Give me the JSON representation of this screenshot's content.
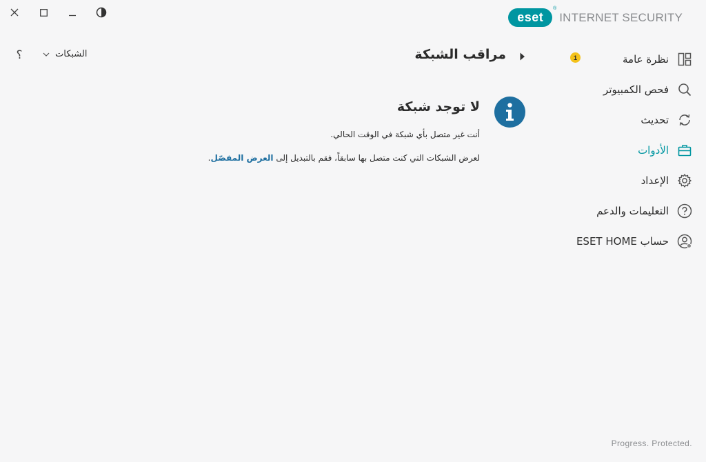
{
  "window": {
    "close_icon": "close-icon",
    "maximize_icon": "maximize-icon",
    "minimize_icon": "minimize-icon",
    "theme_icon": "contrast-icon"
  },
  "brand": {
    "logo_text": "eset",
    "registered": "®",
    "product": "INTERNET SECURITY",
    "accent": "#0096a1"
  },
  "sidebar": {
    "items": [
      {
        "label": "نظرة عامة",
        "icon": "overview-icon",
        "badge": "1"
      },
      {
        "label": "فحص الكمبيوتر",
        "icon": "search-icon"
      },
      {
        "label": "تحديث",
        "icon": "refresh-icon"
      },
      {
        "label": "الأدوات",
        "icon": "toolbox-icon",
        "active": true
      },
      {
        "label": "الإعداد",
        "icon": "gear-icon"
      },
      {
        "label": "التعليمات والدعم",
        "icon": "help-circle-icon"
      },
      {
        "label": "حساب ESET HOME",
        "icon": "account-icon"
      }
    ]
  },
  "header": {
    "title": "مراقب الشبكة",
    "networks_label": "الشبكات",
    "help_label": "؟"
  },
  "message": {
    "title": "لا توجد شبكة",
    "line1": "أنت غير متصل بأي شبكة في الوقت الحالي.",
    "line2_prefix": "لعرض الشبكات التي كنت متصل بها سابقاً، فقم بالتبديل إلى ",
    "line2_link": "العرض المفصّل",
    "line2_suffix": "."
  },
  "footer": {
    "tagline": "Progress. Protected."
  },
  "colors": {
    "accent": "#0096a1",
    "info": "#1e6fa0",
    "badge": "#f4c21a",
    "background": "#f6f6f7"
  }
}
